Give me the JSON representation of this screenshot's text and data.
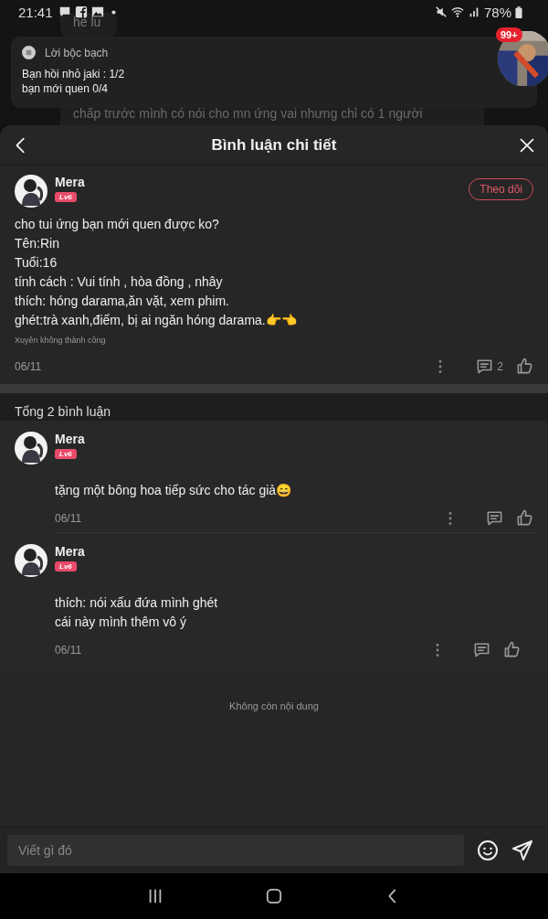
{
  "status_bar": {
    "time": "21:41",
    "battery": "78%"
  },
  "background": {
    "texts": [
      "hê lu",
      "chấp trước mình có nói cho mn ứng vai nhưng chỉ có 1 người"
    ]
  },
  "notification": {
    "title": "Lời bộc bạch",
    "lines": [
      "Bạn hồi nhỏ jaki : 1/2",
      "bạn mới quen 0/4"
    ]
  },
  "floating_badge": "99+",
  "sheet": {
    "title": "Bình luận chi tiết"
  },
  "main_comment": {
    "author": "Mera",
    "level": "Lv6",
    "follow_button": "Theo dõi",
    "lines": [
      "cho tui ứng bạn mới quen được ko?",
      "Tên:Rin",
      "Tuổi:16",
      "tính cách : Vui tính , hòa đồng , nhây",
      "thích: hóng darama,ăn vặt, xem phim.",
      "ghét:trà xanh,điếm, bị ai ngăn hóng darama.👉👈"
    ],
    "note": "Xuyên không thành công",
    "date": "06/11",
    "reply_count": "2"
  },
  "total": "Tổng 2 bình luận",
  "replies": [
    {
      "author": "Mera",
      "level": "Lv6",
      "lines": [
        "tặng một bông hoa tiếp sức cho tác giả😄"
      ],
      "date": "06/11"
    },
    {
      "author": "Mera",
      "level": "Lv6",
      "lines": [
        "thích: nói xấu đứa mình ghét",
        "cái này mình thêm vô ý"
      ],
      "date": "06/11"
    }
  ],
  "end_text": "Không còn nội dung",
  "input": {
    "placeholder": "Viết gì đó"
  }
}
